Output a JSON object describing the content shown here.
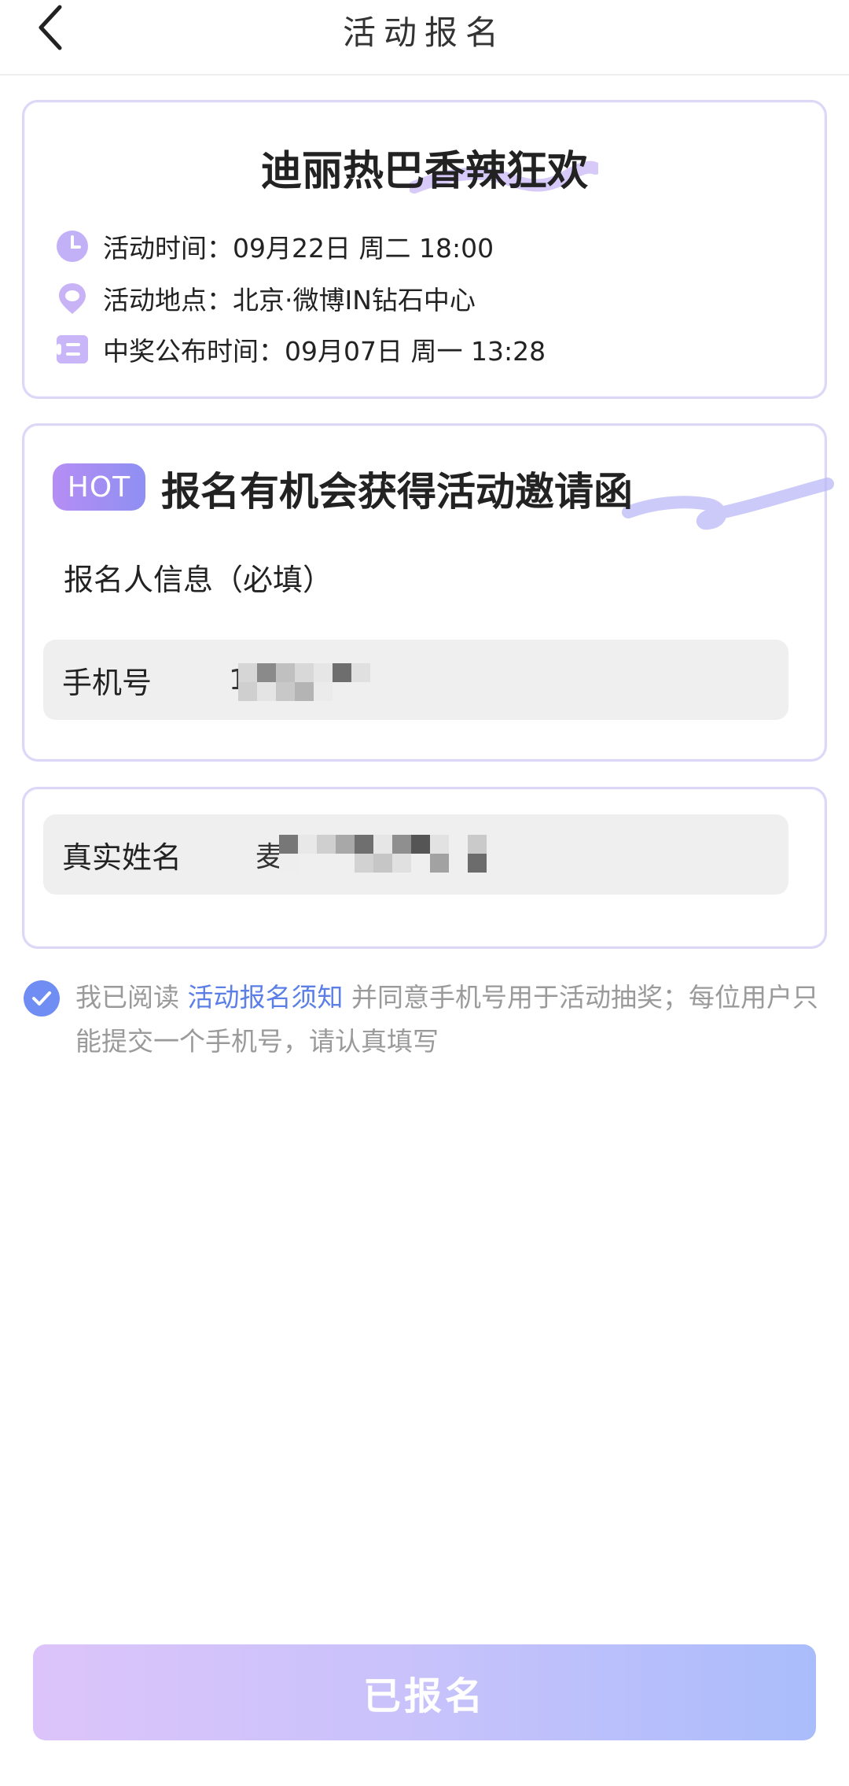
{
  "header": {
    "title": "活动报名",
    "back_icon": "chevron-left-icon"
  },
  "event": {
    "title": "迪丽热巴香辣狂欢",
    "time": {
      "icon": "clock-icon",
      "label": "活动时间：",
      "value": "09月22日 周二 18:00"
    },
    "location": {
      "icon": "location-pin-icon",
      "label": "活动地点：",
      "value": "北京·微博IN钻石中心"
    },
    "announce": {
      "icon": "ticket-icon",
      "label": "中奖公布时间：",
      "value": "09月07日 周一 13:28"
    }
  },
  "signup": {
    "badge": "HOT",
    "heading": "报名有机会获得活动邀请函",
    "section_label": "报名人信息（必填）",
    "phone": {
      "label": "手机号",
      "value_prefix": "1"
    },
    "name": {
      "label": "真实姓名",
      "value_prefix": "麦"
    }
  },
  "agreement": {
    "checked": true,
    "prefix": "我已阅读 ",
    "link": "活动报名须知",
    "suffix": " 并同意手机号用于活动抽奖；每位用户只能提交一个手机号，请认真填写"
  },
  "submit": {
    "label": "已报名"
  },
  "colors": {
    "accent": "#6f8df2",
    "link": "#5b7fe6",
    "card_border": "#dcd6f7",
    "button_start": "#dcc4fa",
    "button_end": "#aabdfb"
  }
}
